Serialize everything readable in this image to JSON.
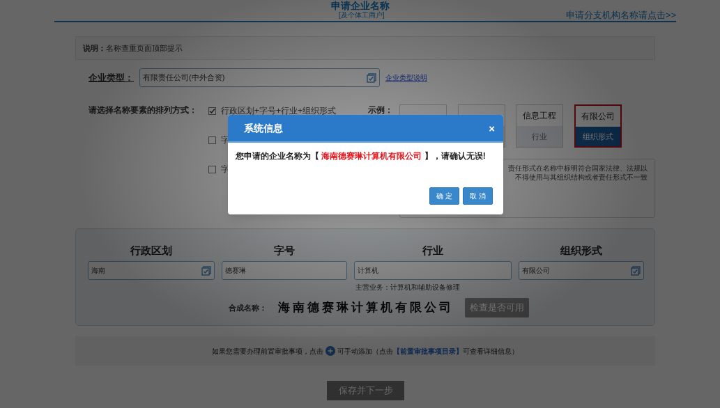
{
  "header": {
    "title": "申请企业名称",
    "subtitle": "[及个体工商户]",
    "branch_link": "申请分支机构名称请点击>>"
  },
  "notice": {
    "label": "说明：",
    "text": "名称查重页面顶部提示"
  },
  "enterprise_type": {
    "label": "企业类型：",
    "value": "有限责任公司(中外合资)",
    "help_link": "企业类型说明"
  },
  "arrangement": {
    "label": "请选择名称要素的排列方式：",
    "options": [
      {
        "label": "行政区划+字号+行业+组织形式",
        "checked": true
      },
      {
        "label": "字",
        "checked": false
      },
      {
        "label": "字",
        "checked": false
      }
    ],
    "example_label": "示例：",
    "examples": [
      {
        "selected": false
      },
      {
        "selected": false
      },
      {
        "text": "信息工程",
        "caption": "行业",
        "selected": false
      },
      {
        "text": "有限公司",
        "caption": "组织形式",
        "selected": true
      }
    ],
    "description_lines": [
      "责任形式在名称中标明符合国家法律、法规以",
      "不得使用与其组织结构或者责任形式不一致"
    ]
  },
  "composition": {
    "fields": [
      {
        "heading": "行政区划",
        "value": "海南",
        "kind": "select"
      },
      {
        "heading": "字号",
        "value": "德赛琳",
        "kind": "text"
      },
      {
        "heading": "行业",
        "value": "计算机",
        "kind": "text",
        "note": "主营业务：计算机和辅助设备修理"
      },
      {
        "heading": "组织形式",
        "value": "有限公司",
        "kind": "select"
      }
    ],
    "composed_label": "合成名称：",
    "composed_name": "海南德赛琳计算机有限公司",
    "check_button": "检查是否可用"
  },
  "prerequisite": {
    "before": "如果您需要办理前置审批事项，点击",
    "after": "可手动添加（点击",
    "link": "【前置审批事项目录】",
    "tail": "可查看详细信息）"
  },
  "save_button": "保存并下一步",
  "dialog": {
    "title": "系统信息",
    "close": "×",
    "message_before": "您申请的企业名称为【",
    "message_highlight": "海南德赛琳计算机有限公司",
    "message_after": "】，请确认无误!",
    "buttons": [
      "确 定",
      "取 消"
    ]
  }
}
